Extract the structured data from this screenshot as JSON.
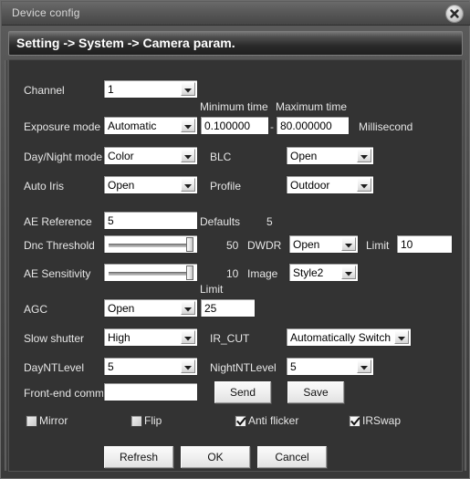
{
  "window": {
    "title": "Device config",
    "close_icon": "close-icon"
  },
  "header": {
    "breadcrumb": "Setting -> System -> Camera param."
  },
  "form": {
    "channel": {
      "label": "Channel",
      "value": "1"
    },
    "exposure": {
      "label": "Exposure mode",
      "value": "Automatic",
      "min_time_label": "Minimum time",
      "min_time_value": "0.100000",
      "separator": "-",
      "max_time_label": "Maximum time",
      "max_time_value": "80.000000",
      "unit": "Millisecond"
    },
    "daynight": {
      "label": "Day/Night mode",
      "value": "Color"
    },
    "blc": {
      "label": "BLC",
      "value": "Open"
    },
    "auto_iris": {
      "label": "Auto Iris",
      "value": "Open"
    },
    "profile": {
      "label": "Profile",
      "value": "Outdoor"
    },
    "ae_reference": {
      "label": "AE Reference",
      "value": "5",
      "defaults_label": "Defaults",
      "defaults_value": "5"
    },
    "dnc_threshold": {
      "label": "Dnc Threshold",
      "value": "50",
      "percent": 92
    },
    "dwdr": {
      "label": "DWDR",
      "value": "Open",
      "limit_label": "Limit",
      "limit_value": "10"
    },
    "ae_sensitivity": {
      "label": "AE Sensitivity",
      "value": "10",
      "percent": 92
    },
    "image": {
      "label": "Image",
      "value": "Style2"
    },
    "agc": {
      "label": "AGC",
      "value": "Open",
      "limit_label": "Limit",
      "limit_value": "25"
    },
    "slow_shutter": {
      "label": "Slow shutter",
      "value": "High"
    },
    "ir_cut": {
      "label": "IR_CUT",
      "value": "Automatically Switch"
    },
    "day_nt_level": {
      "label": "DayNTLevel",
      "value": "5"
    },
    "night_nt_level": {
      "label": "NightNTLevel",
      "value": "5"
    },
    "front_end_comm": {
      "label": "Front-end comm",
      "value": "",
      "placeholder": ""
    },
    "send_button": "Send",
    "save_button": "Save"
  },
  "checkboxes": [
    {
      "label": "Mirror",
      "checked": false
    },
    {
      "label": "Flip",
      "checked": false
    },
    {
      "label": "Anti flicker",
      "checked": true
    },
    {
      "label": "IRSwap",
      "checked": true
    }
  ],
  "footer": {
    "refresh": "Refresh",
    "ok": "OK",
    "cancel": "Cancel"
  }
}
